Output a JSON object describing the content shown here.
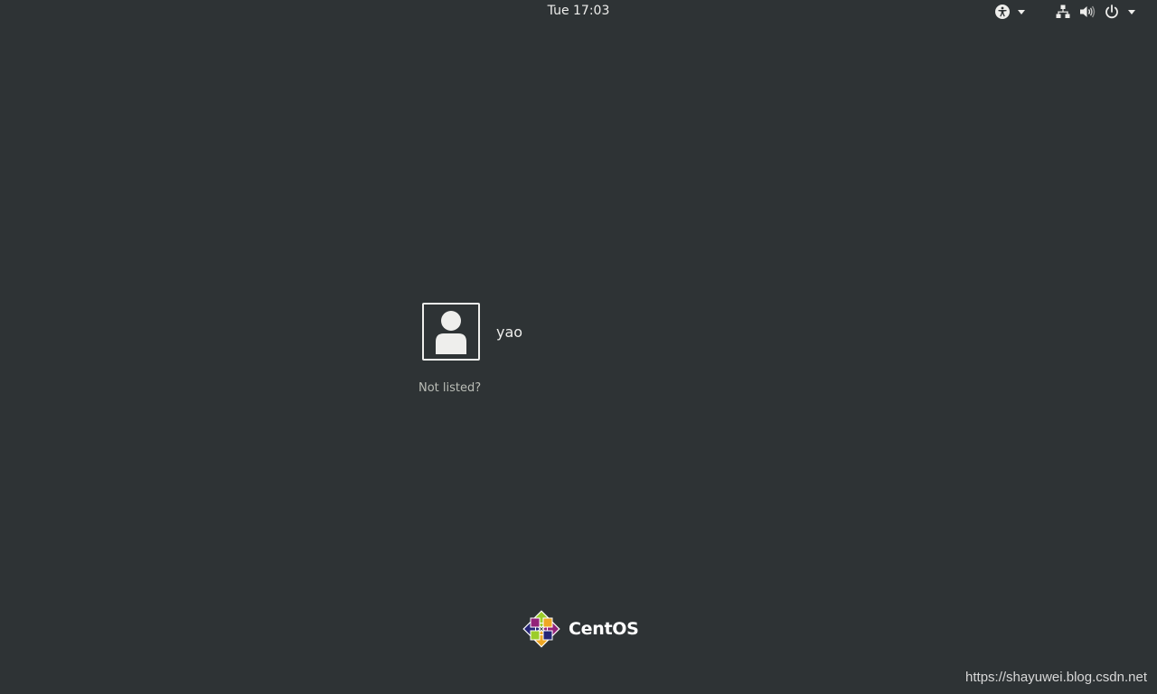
{
  "topbar": {
    "clock": "Tue 17:03",
    "icons": {
      "accessibility": "accessibility-icon",
      "network": "network-wired-icon",
      "volume": "volume-icon",
      "power": "power-icon",
      "dropdown": "chevron-down-icon"
    }
  },
  "login": {
    "users": [
      {
        "name": "yao",
        "avatar": "user-avatar-icon"
      }
    ],
    "not_listed_label": "Not listed?"
  },
  "branding": {
    "logo_text": "CentOS",
    "logo_icon": "centos-logo-icon"
  },
  "watermark": "https://shayuwei.blog.csdn.net",
  "colors": {
    "background": "#2e3335",
    "foreground": "#eeeeec",
    "muted": "#babdb6"
  }
}
